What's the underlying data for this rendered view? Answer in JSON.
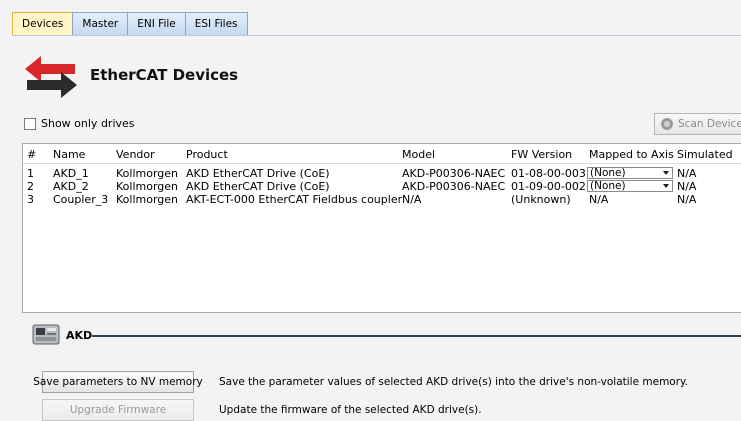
{
  "tabs": [
    {
      "label": "Devices",
      "active": true
    },
    {
      "label": "Master",
      "active": false
    },
    {
      "label": "ENI File",
      "active": false
    },
    {
      "label": "ESI Files",
      "active": false
    }
  ],
  "header": {
    "title": "EtherCAT Devices",
    "icon": "ethercat-arrows-icon"
  },
  "filter": {
    "show_only_drives_label": "Show only drives",
    "checked": false
  },
  "toolbar": {
    "scan_label": "Scan Devices",
    "scan_icon": "scan-icon"
  },
  "table": {
    "columns": [
      "#",
      "Name",
      "Vendor",
      "Product",
      "Model",
      "FW Version",
      "Mapped to Axis",
      "Simulated"
    ],
    "rows": [
      {
        "num": "1",
        "name": "AKD_1",
        "vendor": "Kollmorgen",
        "product": "AKD EtherCAT Drive (CoE)",
        "model": "AKD-P00306-NAEC",
        "fw": "01-08-00-003",
        "axis": "(None)",
        "axis_is_dropdown": true,
        "simulated": "N/A"
      },
      {
        "num": "2",
        "name": "AKD_2",
        "vendor": "Kollmorgen",
        "product": "AKD EtherCAT Drive (CoE)",
        "model": "AKD-P00306-NAEC",
        "fw": "01-09-00-002",
        "axis": "(None)",
        "axis_is_dropdown": true,
        "simulated": "N/A"
      },
      {
        "num": "3",
        "name": "Coupler_3",
        "vendor": "Kollmorgen",
        "product": "AKT-ECT-000 EtherCAT Fieldbus coupler",
        "model": "N/A",
        "fw": "(Unknown)",
        "axis": "N/A",
        "axis_is_dropdown": false,
        "simulated": "N/A"
      }
    ]
  },
  "akd": {
    "section_label": "AKD",
    "icon": "akd-drive-icon",
    "save_button": "Save parameters to NV memory",
    "save_desc": "Save the parameter values of selected AKD drive(s) into the drive's non-volatile memory.",
    "upgrade_button": "Upgrade Firmware",
    "upgrade_desc": "Update the firmware of the selected AKD drive(s)."
  },
  "colors": {
    "active_tab": "#fff5c7",
    "section_line": "#27415f",
    "arrow_red": "#d9262a"
  }
}
